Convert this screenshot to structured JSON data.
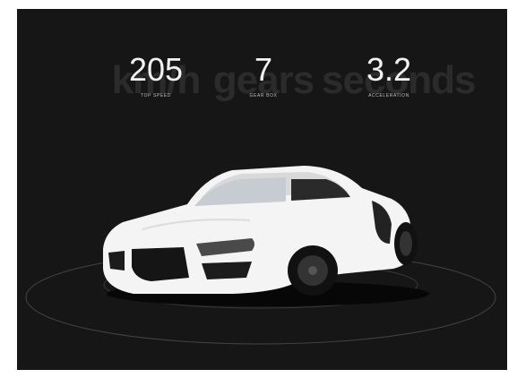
{
  "stats": [
    {
      "value": "205",
      "label": "TOP SPEED",
      "ghost": "km/h"
    },
    {
      "value": "7",
      "label": "GEAR BOX",
      "ghost": "gears"
    },
    {
      "value": "3.2",
      "label": "ACCELERATION",
      "ghost": "seconds"
    }
  ],
  "colors": {
    "background": "#161616",
    "car_body": "#f4f4f4",
    "text": "#f2f2f2",
    "ghost_text": "#2b2b2b",
    "orbit_line": "#4a4a4a"
  }
}
